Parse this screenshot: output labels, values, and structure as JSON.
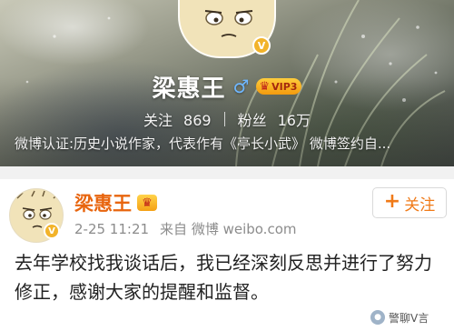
{
  "profile": {
    "name": "梁惠王",
    "gender_icon": "male-icon",
    "vip_label": "VIP3",
    "stats": {
      "following_label": "关注",
      "following_count": "869",
      "fans_label": "粉丝",
      "fans_count": "16万"
    },
    "certification": "微博认证:历史小说作家，代表作有《亭长小武》 微博签约自..."
  },
  "post": {
    "author": "梁惠王",
    "timestamp": "2-25 11:21",
    "source": "来自 微博 weibo.com",
    "follow_label": "关注",
    "content": "去年学校找我谈话后，我已经深刻反思并进行了努力修正，感谢大家的提醒和监督。"
  },
  "watermark": {
    "text": "警聊V言"
  },
  "icons": {
    "verify": "verified-badge-icon",
    "crown": "crown-icon",
    "plus": "plus-icon",
    "male": "male-icon"
  },
  "colors": {
    "username_orange": "#e8650e",
    "follow_orange": "#f07a18",
    "verify_gold": "#f2b32a",
    "vip_gold": "#f5a116",
    "meta_gray": "#8c8c8c"
  }
}
